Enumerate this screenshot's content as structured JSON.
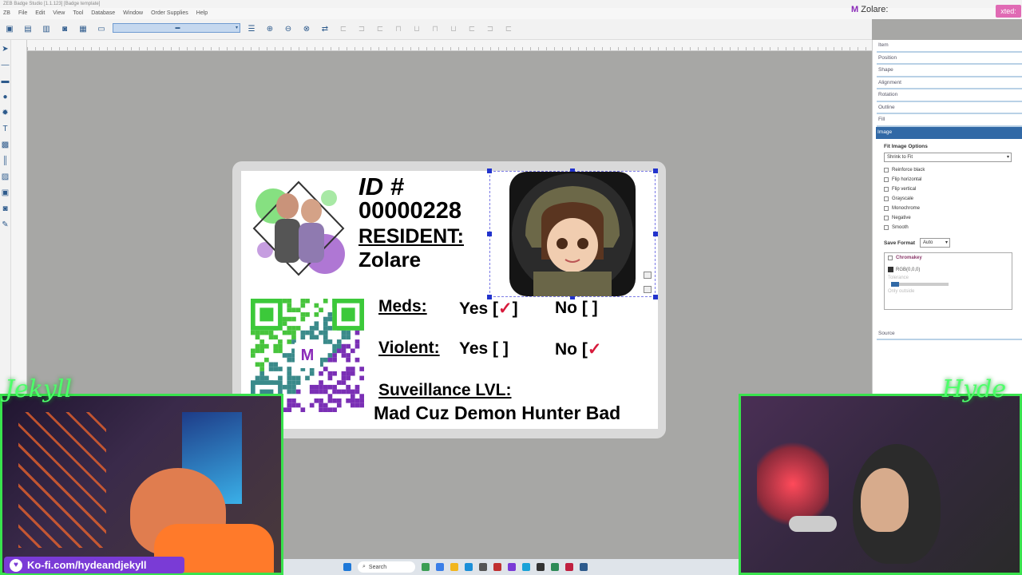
{
  "app": {
    "title": "ZEB Badge Studio [1.1.123] [Badge template]",
    "brand_mark": "M",
    "brand_name": "Zolare:",
    "brand_tag": "xted:"
  },
  "menu": [
    "ZB",
    "File",
    "Edit",
    "View",
    "Tool",
    "Database",
    "Window",
    "Order Supplies",
    "Help"
  ],
  "panel": {
    "sections_top": [
      "Item",
      "Position",
      "Shape",
      "Alignment",
      "Rotation",
      "Outline",
      "Fill"
    ],
    "active_section": "Image",
    "fit_options_label": "Fit Image Options",
    "fit_option_value": "Shrink to Fit",
    "checkboxes": [
      "Reinforce black",
      "Flip horizontal",
      "Flip vertical",
      "Grayscale",
      "Monochrome",
      "Negative",
      "Smooth"
    ],
    "save_format_label": "Save Format",
    "save_format_value": "Auto",
    "chromakey_label": "Chromakey",
    "chromakey_color": "RGB(0,0,0)",
    "tolerance_label": "Tolerance",
    "only_outside_label": "Only outside",
    "source_label": "Source"
  },
  "badge": {
    "id_label": "ID #",
    "id_number": "00000228",
    "resident_label": "RESIDENT:",
    "resident_name": "Zolare",
    "meds_label": "Meds:",
    "violent_label": "Violent:",
    "yes_label": "Yes [",
    "no_label": "No [",
    "close_bracket": "]",
    "tick_mark": "✓",
    "surveillance_label": "Suveillance LVL:",
    "surveillance_value": "Mad Cuz Demon Hunter Bad"
  },
  "stream": {
    "left_signature": "Jekyll",
    "right_signature": "Hyde",
    "kofi_text": "Ko-fi.com/hydeandjekyll"
  },
  "taskbar": {
    "search_placeholder": "Search"
  },
  "colors": {
    "accent_green": "#39e24d",
    "panel_active": "#3169a6",
    "kofi_purple": "#7a3bd6",
    "tick_red": "#d71a3b"
  }
}
